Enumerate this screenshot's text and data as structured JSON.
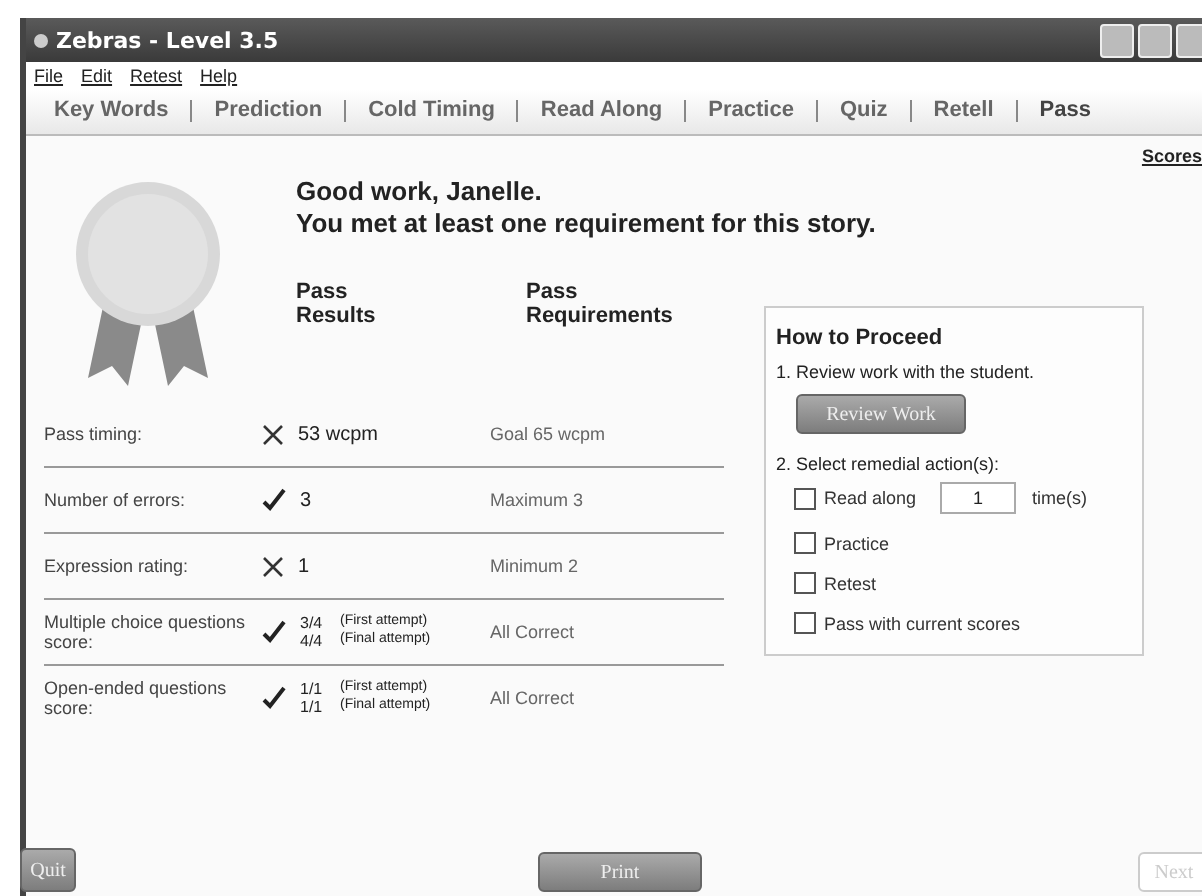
{
  "window": {
    "title": "Zebras - Level 3.5"
  },
  "menu": [
    "File",
    "Edit",
    "Retest",
    "Help"
  ],
  "tabs": [
    {
      "label": "Key Words",
      "selected": false
    },
    {
      "label": "Prediction",
      "selected": false
    },
    {
      "label": "Cold Timing",
      "selected": false
    },
    {
      "label": "Read Along",
      "selected": false
    },
    {
      "label": "Practice",
      "selected": false
    },
    {
      "label": "Quiz",
      "selected": false
    },
    {
      "label": "Retell",
      "selected": false
    },
    {
      "label": "Pass",
      "selected": true
    }
  ],
  "scores_link": "Scores",
  "greeting": [
    "Good work, Janelle.",
    "You met at least one requirement for this story."
  ],
  "columns": [
    "Pass Results",
    "Pass Requirements"
  ],
  "rows": [
    {
      "label": "Pass timing:",
      "passed": false,
      "results": [
        {
          "value": "53 wcpm"
        }
      ],
      "requirement": "Goal 65 wcpm"
    },
    {
      "label": "Number of errors:",
      "passed": true,
      "results": [
        {
          "value": "3"
        }
      ],
      "requirement": "Maximum 3"
    },
    {
      "label": "Expression rating:",
      "passed": false,
      "results": [
        {
          "value": "1"
        }
      ],
      "requirement": "Minimum 2"
    },
    {
      "label": "Multiple choice questions score:",
      "passed": true,
      "results": [
        {
          "value": "3/4",
          "note": "(First attempt)"
        },
        {
          "value": "4/4",
          "note": "(Final attempt)"
        }
      ],
      "requirement": "All Correct"
    },
    {
      "label": "Open-ended questions score:",
      "passed": true,
      "results": [
        {
          "value": "1/1",
          "note": "(First attempt)"
        },
        {
          "value": "1/1",
          "note": "(Final attempt)"
        }
      ],
      "requirement": "All Correct"
    }
  ],
  "proceed": {
    "title": "How to Proceed",
    "step1": "1. Review work with the student.",
    "review_button": "Review Work",
    "step2": "2. Select remedial action(s):",
    "options": [
      {
        "label": "Read along",
        "checked": false,
        "times": "1",
        "suffix": "time(s)"
      },
      {
        "label": "Practice",
        "checked": false
      },
      {
        "label": "Retest",
        "checked": false
      },
      {
        "label": "Pass with current scores",
        "checked": false
      }
    ]
  },
  "buttons": [
    {
      "label": "Quit",
      "disabled": false
    },
    {
      "label": "Print",
      "disabled": false
    },
    {
      "label": "Next",
      "disabled": true
    }
  ]
}
